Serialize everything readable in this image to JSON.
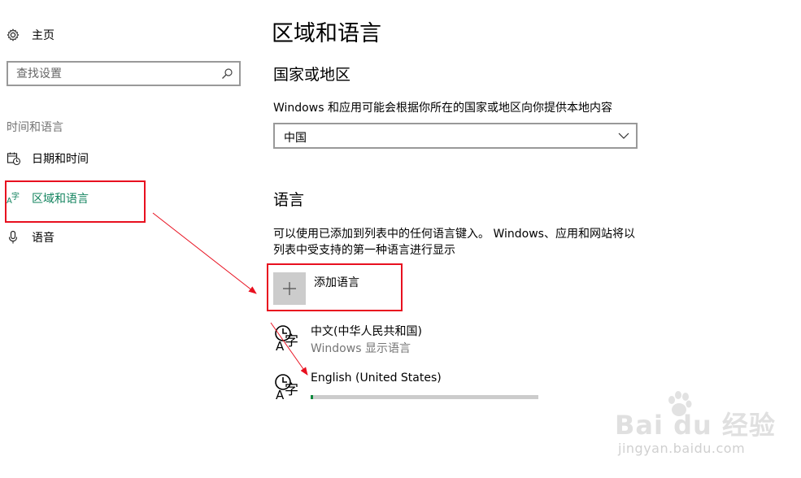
{
  "sidebar": {
    "home_label": "主页",
    "search_placeholder": "查找设置",
    "section_heading": "时间和语言",
    "items": [
      {
        "label": "日期和时间",
        "icon": "calendar-clock-icon"
      },
      {
        "label": "区域和语言",
        "icon": "language-icon",
        "active": true
      },
      {
        "label": "语音",
        "icon": "microphone-icon"
      }
    ]
  },
  "main": {
    "title": "区域和语言",
    "country_heading": "国家或地区",
    "country_description": "Windows 和应用可能会根据你所在的国家或地区向你提供本地内容",
    "country_value": "中国",
    "language_heading": "语言",
    "language_description": "可以使用已添加到列表中的任何语言键入。 Windows、应用和网站将以列表中受支持的第一种语言进行显示",
    "add_language_label": "添加语言",
    "languages": [
      {
        "name": "中文(中华人民共和国)",
        "subtitle": "Windows 显示语言"
      },
      {
        "name": "English (United States)",
        "progress": 0.01
      }
    ]
  },
  "watermark": {
    "main": "Bai du 经验",
    "url": "jingyan.baidu.com"
  },
  "colors": {
    "accent": "#12835e",
    "annotation_red": "#e8101f",
    "progress_green": "#10893e"
  }
}
